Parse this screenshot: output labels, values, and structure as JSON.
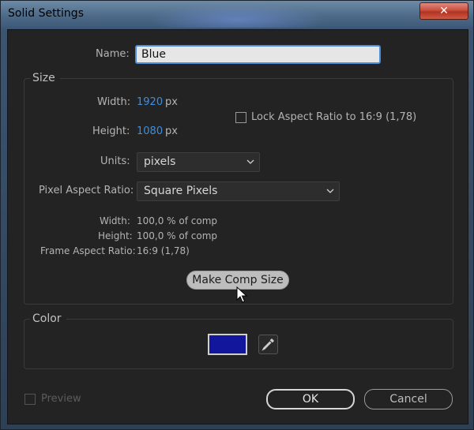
{
  "window": {
    "title": "Solid Settings",
    "close_label": "✕"
  },
  "name_field": {
    "label": "Name:",
    "value": "Blue"
  },
  "size": {
    "group_title": "Size",
    "width_label": "Width:",
    "width_value": "1920",
    "width_unit": "px",
    "height_label": "Height:",
    "height_value": "1080",
    "height_unit": "px",
    "lock_aspect_label": "Lock Aspect Ratio to 16:9 (1,78)",
    "lock_aspect_checked": false,
    "units_label": "Units:",
    "units_value": "pixels",
    "par_label": "Pixel Aspect Ratio:",
    "par_value": "Square Pixels",
    "info": [
      {
        "label": "Width:",
        "value": "100,0 % of comp"
      },
      {
        "label": "Height:",
        "value": "100,0 % of comp"
      },
      {
        "label": "Frame Aspect Ratio:",
        "value": "16:9 (1,78)"
      }
    ],
    "make_comp_size_label": "Make Comp Size"
  },
  "color": {
    "group_title": "Color",
    "swatch_hex": "#12169c",
    "eyedropper_icon": "eyedropper-icon"
  },
  "footer": {
    "preview_label": "Preview",
    "preview_checked": false,
    "ok_label": "OK",
    "cancel_label": "Cancel"
  },
  "colors": {
    "accent_blue": "#3c8fe0",
    "focus_border": "#4e8ed6",
    "dialog_bg": "#232323"
  }
}
